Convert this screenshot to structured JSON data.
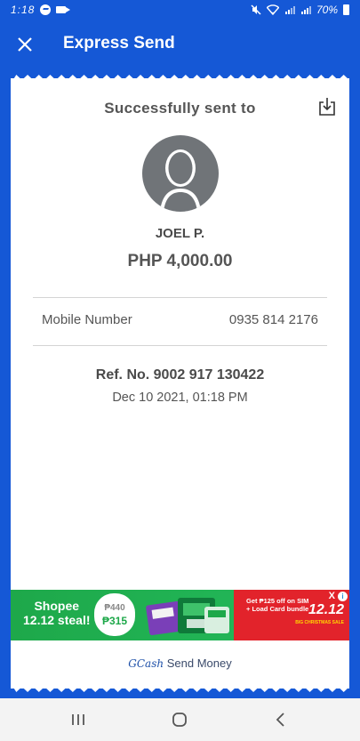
{
  "status_bar": {
    "time": "1:18",
    "battery": "70%",
    "icons": [
      "messenger-icon",
      "video-call-icon",
      "mute-icon",
      "wifi-icon",
      "signal-icon",
      "signal-icon",
      "battery-icon"
    ]
  },
  "app_bar": {
    "title": "Express Send",
    "close_icon": "close-icon"
  },
  "receipt": {
    "heading": "Successfully sent to",
    "download_icon": "download-icon",
    "recipient_name": "JOEL P.",
    "amount": "PHP 4,000.00",
    "details": [
      {
        "label": "Mobile Number",
        "value": "0935 814 2176"
      }
    ],
    "reference": "Ref. No. 9002 917 130422",
    "date": "Dec 10 2021, 01:18 PM"
  },
  "ad_banner": {
    "headline_line1": "Shopee",
    "headline_line2": "12.12 steal!",
    "old_price": "₱440",
    "new_price": "₱315",
    "promo_text": "Get ₱125 off on SIM + Load Card bundle",
    "promo_big": "12.12",
    "promo_small": "BIG CHRISTMAS SALE",
    "adchoices_label": "i",
    "close_label": "X"
  },
  "footer": {
    "brand": "GCash",
    "label": "Send Money"
  },
  "colors": {
    "brand_blue": "#1558d6",
    "text_gray": "#555555",
    "avatar_gray": "#707478",
    "banner_green": "#1ea84a",
    "banner_red": "#e2232b"
  },
  "nav_bar": {
    "icons": [
      "recent-apps-icon",
      "home-icon",
      "back-icon"
    ]
  }
}
